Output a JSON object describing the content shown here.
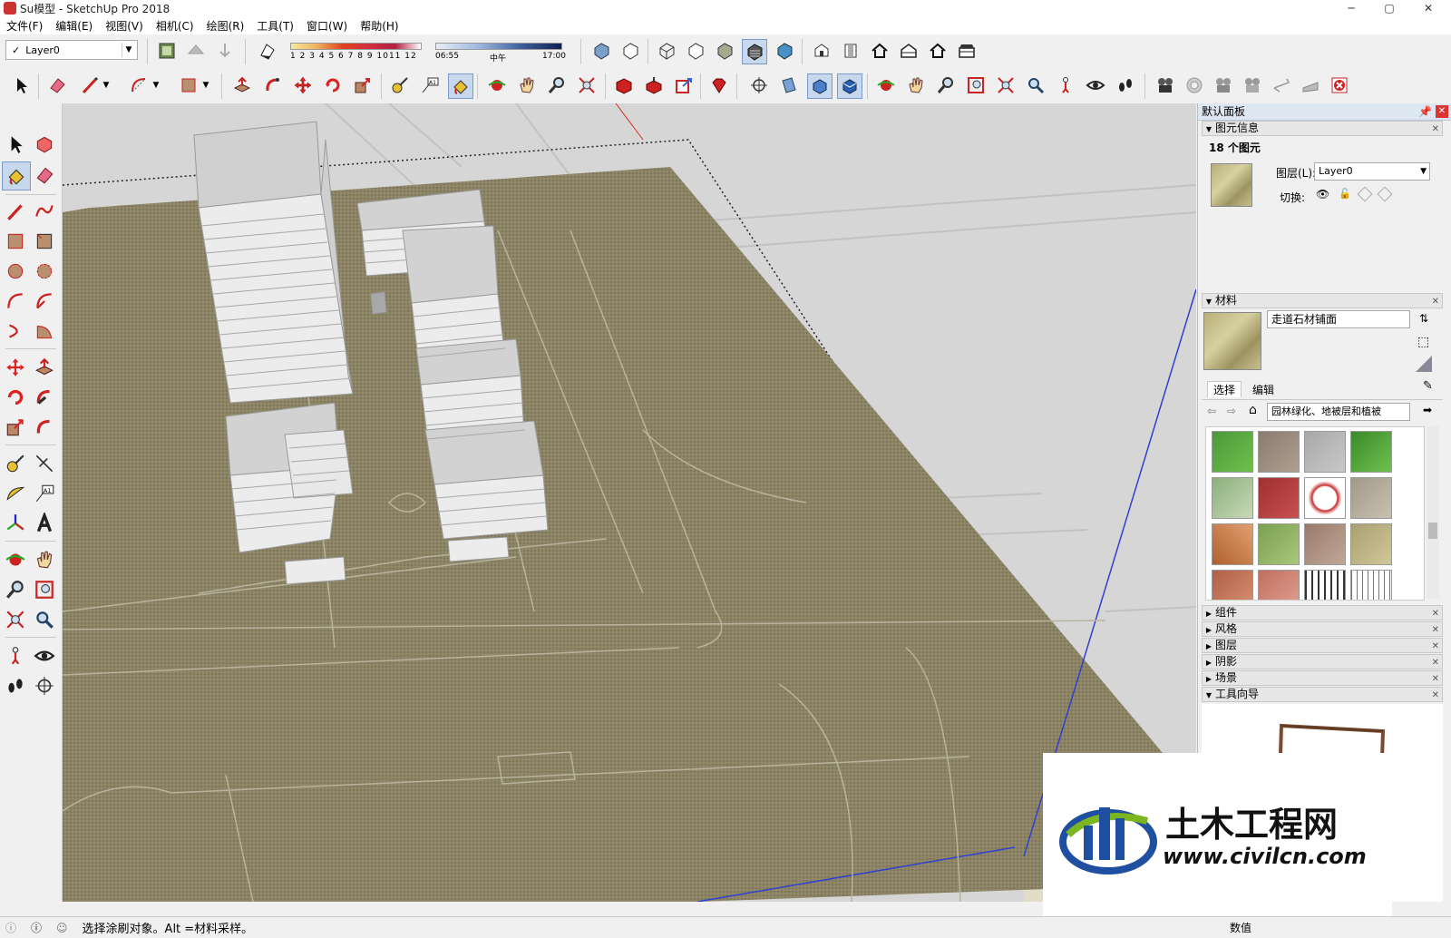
{
  "window": {
    "title": "Su模型 - SketchUp Pro 2018",
    "min": "─",
    "max": "▢",
    "close": "✕"
  },
  "menu": [
    "文件(F)",
    "编辑(E)",
    "视图(V)",
    "相机(C)",
    "绘图(R)",
    "工具(T)",
    "窗口(W)",
    "帮助(H)"
  ],
  "layer_select": {
    "check": "✓",
    "value": "Layer0"
  },
  "shadow": {
    "months": [
      "1",
      "2",
      "3",
      "4",
      "5",
      "6",
      "7",
      "8",
      "9",
      "10",
      "11",
      "12"
    ],
    "time_start": "06:55",
    "time_mid": "中午",
    "time_end": "17:00"
  },
  "panel": {
    "title": "默认面板",
    "entity_info": {
      "header": "图元信息",
      "count": "18 个图元",
      "layer_label": "图层(L):",
      "layer_value": "Layer0",
      "toggle_label": "切换:"
    },
    "materials": {
      "header": "材料",
      "name": "走道石材铺面",
      "tab_select": "选择",
      "tab_edit": "编辑",
      "collection": "园林绿化、地被层和植被"
    },
    "sections": [
      "组件",
      "风格",
      "图层",
      "阴影",
      "场景"
    ],
    "instructor": "工具向导"
  },
  "status": {
    "text": "选择涂刷对象。Alt =材料采样。",
    "measure_label": "数值"
  },
  "logo": {
    "name": "土木工程网",
    "url": "www.civilcn.com"
  },
  "colors": {
    "ground": "#8c8465",
    "building_face": "#ececec",
    "building_top": "#d2d2d2",
    "axis_blue": "#3040d0",
    "axis_red": "#d03020",
    "logo_blue": "#1f4fa0",
    "logo_green": "#7bb51f"
  }
}
